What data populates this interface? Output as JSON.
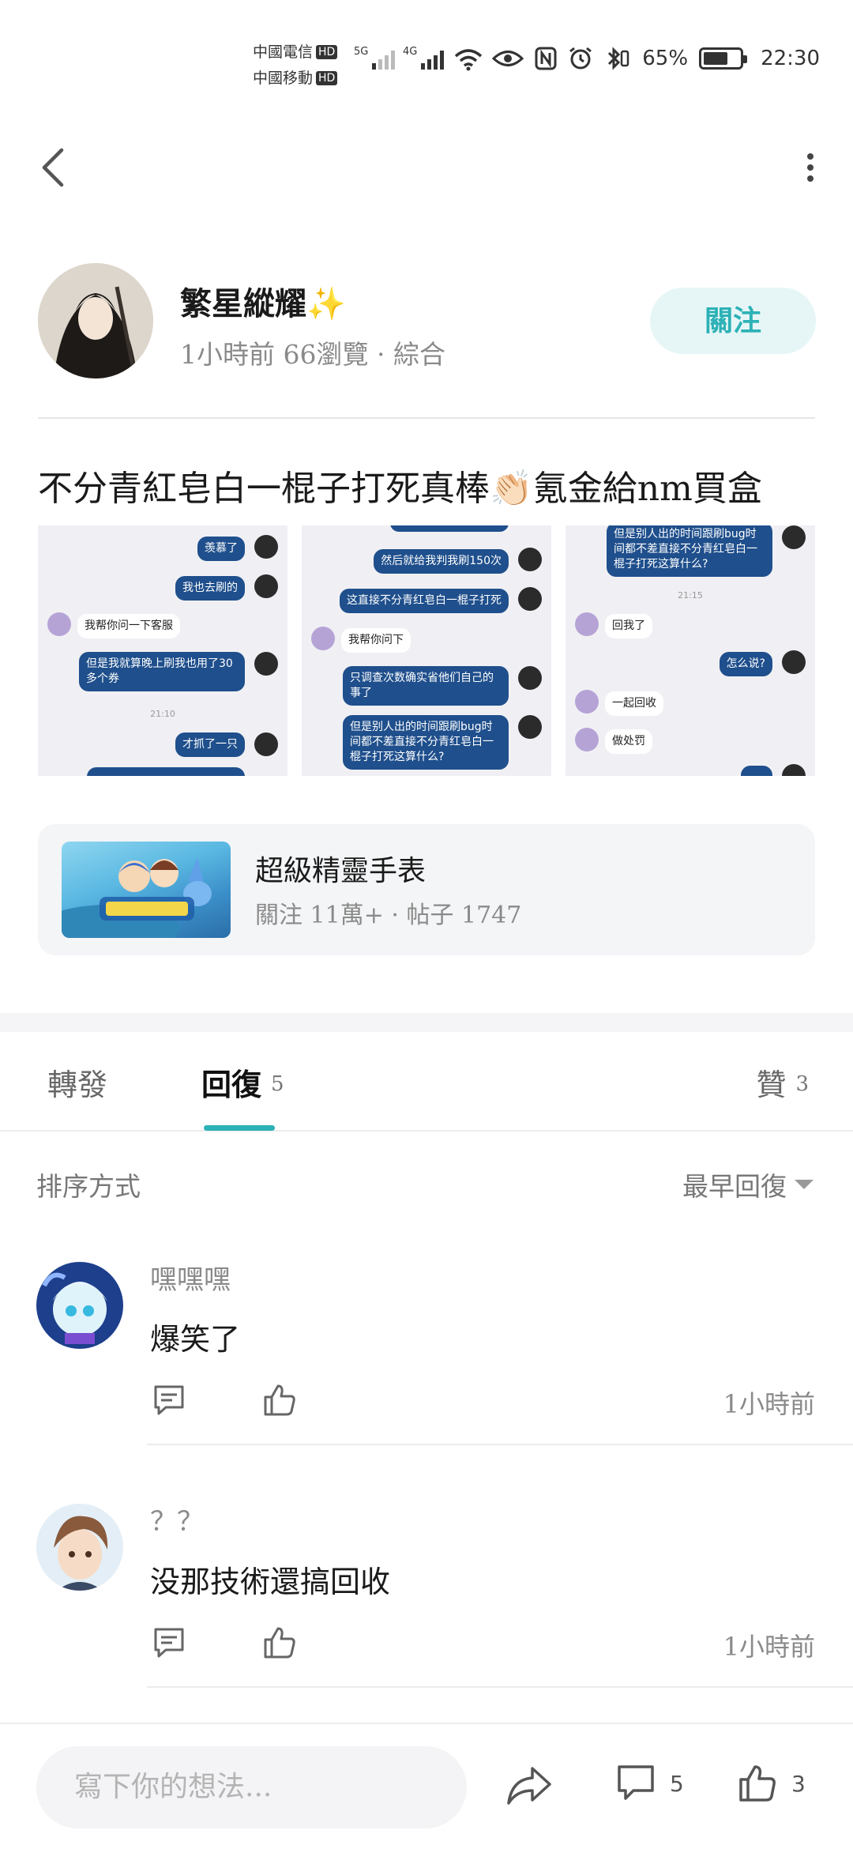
{
  "status_bar": {
    "carrier_1": "中國電信",
    "carrier_2": "中國移動",
    "hd": "HD",
    "net_1": "5G",
    "net_2": "4G",
    "battery": "65%",
    "time": "22:30"
  },
  "header": {
    "back_icon": "chevron-left-icon",
    "more_icon": "vertical-ellipsis-icon"
  },
  "author": {
    "name": "繁星縱耀✨",
    "meta": "1小時前 66瀏覽 · 綜合",
    "follow_label": "關注"
  },
  "post": {
    "title": "不分青紅皂白一棍子打死真棒👏🏻氪金給nm買盒",
    "screenshots": [
      {
        "bubbles": [
          "羡慕了",
          "我也去刷的",
          "我帮你问一下客服",
          "但是我就算晚上刷我也用了30多个券",
          "21:10",
          "才抓了一只"
        ]
      },
      {
        "bubbles": [
          "然后就给我判我刷150次",
          "这直接不分青红皂白一棍子打死",
          "我帮你问下",
          "只调查次数确实省他们自己的事了",
          "但是别人出的时间跟刷bug时间都不差直接不分青红皂白一棍子打死这算什么?"
        ]
      },
      {
        "bubbles": [
          "但是别人出的时间跟刷bug时间都不差直接不分青红皂白一棍子打死这算什么?",
          "21:15",
          "回我了",
          "怎么说?",
          "一起回收",
          "做处罚"
        ]
      }
    ]
  },
  "community": {
    "name": "超級精靈手表",
    "meta": "關注 11萬+ · 帖子 1747"
  },
  "tabs": [
    {
      "label": "轉發",
      "count": ""
    },
    {
      "label": "回復",
      "count": "5"
    },
    {
      "label": "贊",
      "count": "3"
    }
  ],
  "sort": {
    "label": "排序方式",
    "value": "最早回復"
  },
  "comments": [
    {
      "name": "嘿嘿嘿",
      "text": "爆笑了",
      "time": "1小時前"
    },
    {
      "name": "？？",
      "text": "没那技術還搞回收",
      "time": "1小時前"
    }
  ],
  "bottom_bar": {
    "input_placeholder": "寫下你的想法...",
    "comment_count": "5",
    "like_count": "3"
  },
  "colors": {
    "accent": "#2cb1b6",
    "follow_bg": "#e6f6f6",
    "bubble_blue": "#1f4f8c"
  }
}
